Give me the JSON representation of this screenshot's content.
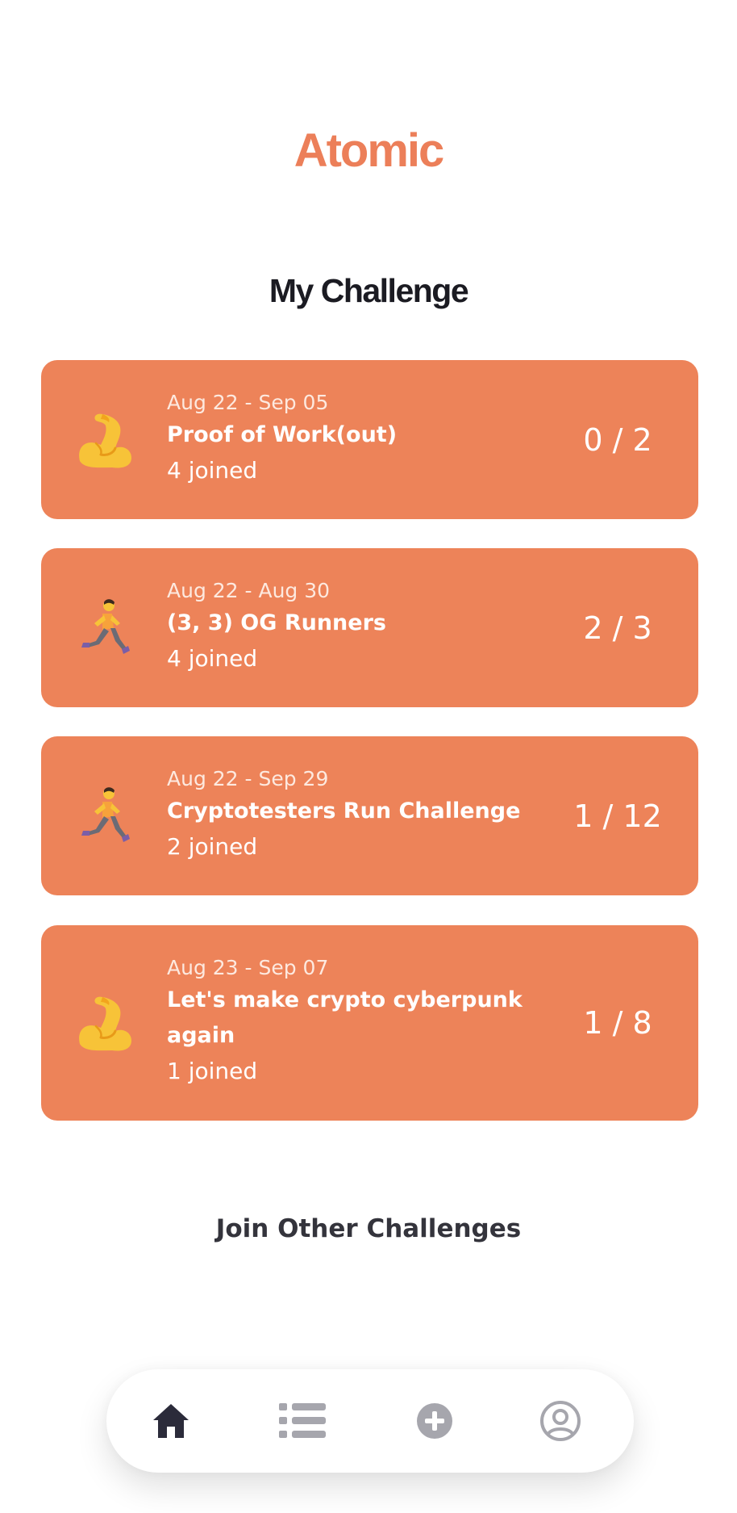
{
  "app": {
    "title": "Atomic",
    "accent_color": "#ec7f59",
    "card_color": "#ed8359"
  },
  "section": {
    "title": "My Challenge"
  },
  "challenges": [
    {
      "icon": "flexed-biceps-icon",
      "dates": "Aug 22 - Sep 05",
      "name": "Proof of Work(out)",
      "joined": "4 joined",
      "progress": "0 / 2"
    },
    {
      "icon": "runner-icon",
      "dates": "Aug 22 - Aug 30",
      "name": "(3, 3) OG Runners",
      "joined": "4 joined",
      "progress": "2 / 3"
    },
    {
      "icon": "runner-icon",
      "dates": "Aug 22 - Sep 29",
      "name": "Cryptotesters Run Challenge",
      "joined": "2 joined",
      "progress": "1 / 12"
    },
    {
      "icon": "flexed-biceps-icon",
      "dates": "Aug 23 - Sep 07",
      "name": "Let's make crypto cyberpunk again",
      "joined": "1 joined",
      "progress": "1 / 8"
    }
  ],
  "join_link": {
    "label": "Join Other Challenges"
  },
  "nav": {
    "items": [
      {
        "icon": "home-icon",
        "active": true,
        "color": "#2b2b3a"
      },
      {
        "icon": "list-icon",
        "active": false,
        "color": "#a6a6ad"
      },
      {
        "icon": "plus-circle-icon",
        "active": false,
        "color": "#a6a6ad"
      },
      {
        "icon": "user-circle-icon",
        "active": false,
        "color": "#a6a6ad"
      }
    ]
  }
}
